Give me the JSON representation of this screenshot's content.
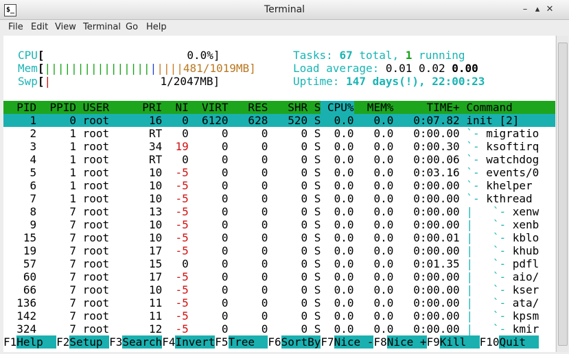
{
  "window": {
    "title": "Terminal",
    "icon_glyph": "$_"
  },
  "menu": [
    "File",
    "Edit",
    "View",
    "Terminal",
    "Go",
    "Help"
  ],
  "meters": {
    "cpu_label": "CPU",
    "cpu_value": "0.0%]",
    "mem_label": "Mem",
    "mem_value": "481/1019MB]",
    "swp_label": "Swp",
    "swp_value": "1/2047MB]"
  },
  "summary": {
    "tasks_label": "Tasks:",
    "tasks_total": "67",
    "tasks_total_text": " total,",
    "tasks_running": "1",
    "tasks_running_text": " running",
    "load_label": "Load average:",
    "load_1": "0.01",
    "load_5": "0.02",
    "load_15": "0.00",
    "uptime_label": "Uptime:",
    "uptime_value": "147 days(!), 22:00:23"
  },
  "columns": [
    "PID",
    "PPID",
    "USER",
    "PRI",
    "NI",
    "VIRT",
    "RES",
    "SHR",
    "S",
    "CPU%",
    "MEM%",
    "TIME+",
    "Command"
  ],
  "processes": [
    {
      "pid": "1",
      "ppid": "0",
      "user": "root",
      "pri": "16",
      "ni": "0",
      "virt": "6120",
      "res": "628",
      "shr": "520",
      "s": "S",
      "cpu": "0.0",
      "mem": "0.0",
      "time": "0:07.82",
      "tree": "",
      "cmd": "init [2]"
    },
    {
      "pid": "2",
      "ppid": "1",
      "user": "root",
      "pri": "RT",
      "ni": "0",
      "virt": "0",
      "res": "0",
      "shr": "0",
      "s": "S",
      "cpu": "0.0",
      "mem": "0.0",
      "time": "0:00.00",
      "tree": "`- ",
      "cmd": "migratio"
    },
    {
      "pid": "3",
      "ppid": "1",
      "user": "root",
      "pri": "34",
      "ni": "19",
      "virt": "0",
      "res": "0",
      "shr": "0",
      "s": "S",
      "cpu": "0.0",
      "mem": "0.0",
      "time": "0:00.30",
      "tree": "`- ",
      "cmd": "ksoftirq"
    },
    {
      "pid": "4",
      "ppid": "1",
      "user": "root",
      "pri": "RT",
      "ni": "0",
      "virt": "0",
      "res": "0",
      "shr": "0",
      "s": "S",
      "cpu": "0.0",
      "mem": "0.0",
      "time": "0:00.06",
      "tree": "`- ",
      "cmd": "watchdog"
    },
    {
      "pid": "5",
      "ppid": "1",
      "user": "root",
      "pri": "10",
      "ni": "-5",
      "virt": "0",
      "res": "0",
      "shr": "0",
      "s": "S",
      "cpu": "0.0",
      "mem": "0.0",
      "time": "0:03.16",
      "tree": "`- ",
      "cmd": "events/0"
    },
    {
      "pid": "6",
      "ppid": "1",
      "user": "root",
      "pri": "10",
      "ni": "-5",
      "virt": "0",
      "res": "0",
      "shr": "0",
      "s": "S",
      "cpu": "0.0",
      "mem": "0.0",
      "time": "0:00.00",
      "tree": "`- ",
      "cmd": "khelper"
    },
    {
      "pid": "7",
      "ppid": "1",
      "user": "root",
      "pri": "10",
      "ni": "-5",
      "virt": "0",
      "res": "0",
      "shr": "0",
      "s": "S",
      "cpu": "0.0",
      "mem": "0.0",
      "time": "0:00.00",
      "tree": "`- ",
      "cmd": "kthread"
    },
    {
      "pid": "8",
      "ppid": "7",
      "user": "root",
      "pri": "13",
      "ni": "-5",
      "virt": "0",
      "res": "0",
      "shr": "0",
      "s": "S",
      "cpu": "0.0",
      "mem": "0.0",
      "time": "0:00.00",
      "tree": "|   `- ",
      "cmd": "xenw"
    },
    {
      "pid": "9",
      "ppid": "7",
      "user": "root",
      "pri": "10",
      "ni": "-5",
      "virt": "0",
      "res": "0",
      "shr": "0",
      "s": "S",
      "cpu": "0.0",
      "mem": "0.0",
      "time": "0:00.00",
      "tree": "|   `- ",
      "cmd": "xenb"
    },
    {
      "pid": "15",
      "ppid": "7",
      "user": "root",
      "pri": "10",
      "ni": "-5",
      "virt": "0",
      "res": "0",
      "shr": "0",
      "s": "S",
      "cpu": "0.0",
      "mem": "0.0",
      "time": "0:00.01",
      "tree": "|   `- ",
      "cmd": "kblo"
    },
    {
      "pid": "19",
      "ppid": "7",
      "user": "root",
      "pri": "17",
      "ni": "-5",
      "virt": "0",
      "res": "0",
      "shr": "0",
      "s": "S",
      "cpu": "0.0",
      "mem": "0.0",
      "time": "0:00.00",
      "tree": "|   `- ",
      "cmd": "khub"
    },
    {
      "pid": "57",
      "ppid": "7",
      "user": "root",
      "pri": "15",
      "ni": "0",
      "virt": "0",
      "res": "0",
      "shr": "0",
      "s": "S",
      "cpu": "0.0",
      "mem": "0.0",
      "time": "0:01.35",
      "tree": "|   `- ",
      "cmd": "pdfl"
    },
    {
      "pid": "60",
      "ppid": "7",
      "user": "root",
      "pri": "17",
      "ni": "-5",
      "virt": "0",
      "res": "0",
      "shr": "0",
      "s": "S",
      "cpu": "0.0",
      "mem": "0.0",
      "time": "0:00.00",
      "tree": "|   `- ",
      "cmd": "aio/"
    },
    {
      "pid": "66",
      "ppid": "7",
      "user": "root",
      "pri": "10",
      "ni": "-5",
      "virt": "0",
      "res": "0",
      "shr": "0",
      "s": "S",
      "cpu": "0.0",
      "mem": "0.0",
      "time": "0:00.00",
      "tree": "|   `- ",
      "cmd": "kser"
    },
    {
      "pid": "136",
      "ppid": "7",
      "user": "root",
      "pri": "11",
      "ni": "-5",
      "virt": "0",
      "res": "0",
      "shr": "0",
      "s": "S",
      "cpu": "0.0",
      "mem": "0.0",
      "time": "0:00.00",
      "tree": "|   `- ",
      "cmd": "ata/"
    },
    {
      "pid": "142",
      "ppid": "7",
      "user": "root",
      "pri": "11",
      "ni": "-5",
      "virt": "0",
      "res": "0",
      "shr": "0",
      "s": "S",
      "cpu": "0.0",
      "mem": "0.0",
      "time": "0:00.00",
      "tree": "|   `- ",
      "cmd": "kpsm"
    },
    {
      "pid": "324",
      "ppid": "7",
      "user": "root",
      "pri": "12",
      "ni": "-5",
      "virt": "0",
      "res": "0",
      "shr": "0",
      "s": "S",
      "cpu": "0.0",
      "mem": "0.0",
      "time": "0:00.00",
      "tree": "|   `- ",
      "cmd": "kmir"
    }
  ],
  "fkeys": [
    {
      "key": "F1",
      "label": "Help  "
    },
    {
      "key": "F2",
      "label": "Setup "
    },
    {
      "key": "F3",
      "label": "Search"
    },
    {
      "key": "F4",
      "label": "Invert"
    },
    {
      "key": "F5",
      "label": "Tree  "
    },
    {
      "key": "F6",
      "label": "SortBy"
    },
    {
      "key": "F7",
      "label": "Nice -"
    },
    {
      "key": "F8",
      "label": "Nice +"
    },
    {
      "key": "F9",
      "label": "Kill  "
    },
    {
      "key": "F10",
      "label": "Quit  "
    }
  ],
  "colors": {
    "header_bg": "#1ea51e",
    "selected_bg": "#1ab0b0",
    "cyan": "#1ab4b4",
    "nice_red": "#d01010"
  }
}
